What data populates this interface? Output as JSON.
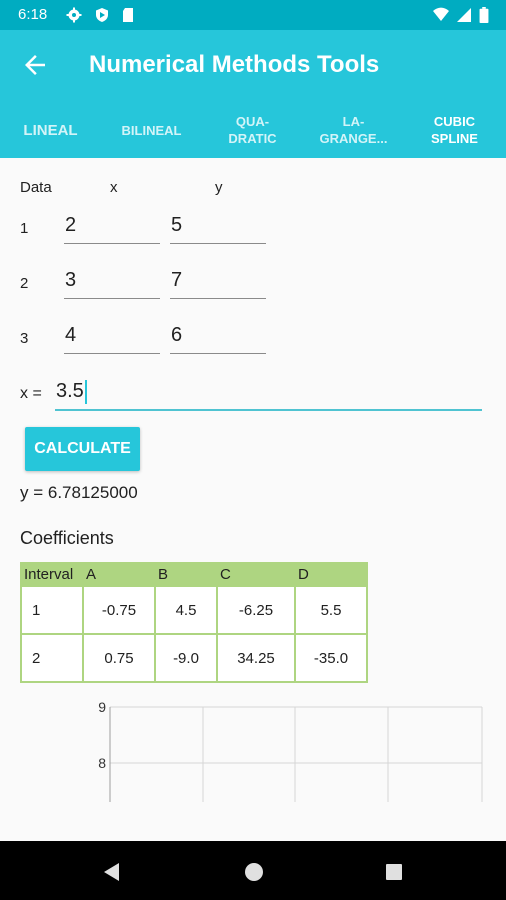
{
  "status": {
    "time": "6:18"
  },
  "appbar": {
    "title": "Numerical Methods Tools"
  },
  "tabs": [
    {
      "label": "LINEAL",
      "active": false
    },
    {
      "label": "BILINEAL",
      "active": false
    },
    {
      "label": "QUA-\nDRATIC",
      "active": false
    },
    {
      "label": "LA-\nGRANGE...",
      "active": false
    },
    {
      "label": "CUBIC\nSPLINE",
      "active": true
    }
  ],
  "form": {
    "header_data": "Data",
    "header_x": "x",
    "header_y": "y",
    "rows": [
      {
        "index": "1",
        "x": "2",
        "y": "5"
      },
      {
        "index": "2",
        "x": "3",
        "y": "7"
      },
      {
        "index": "3",
        "x": "4",
        "y": "6"
      }
    ],
    "x_label": "x =",
    "x_value": "3.5"
  },
  "calculate_label": "CALCULATE",
  "result": "y = 6.78125000",
  "coefficients": {
    "title": "Coefficients",
    "headers": [
      "Interval",
      "A",
      "B",
      "C",
      "D"
    ],
    "rows": [
      [
        "1",
        "-0.75",
        "4.5",
        "-6.25",
        "5.5"
      ],
      [
        "2",
        "0.75",
        "-9.0",
        "34.25",
        "-35.0"
      ]
    ]
  },
  "graph": {
    "y_ticks": [
      "9",
      "8"
    ]
  },
  "colors": {
    "status_bar": "#00acc1",
    "primary": "#26c6da",
    "table_header": "#aed581"
  },
  "icons": {
    "status_left": [
      "settings-icon",
      "shield-icon",
      "sd-card-icon"
    ],
    "status_right": [
      "wifi-icon",
      "signal-icon",
      "battery-icon"
    ],
    "nav": [
      "back-icon",
      "home-icon",
      "recents-icon"
    ]
  }
}
